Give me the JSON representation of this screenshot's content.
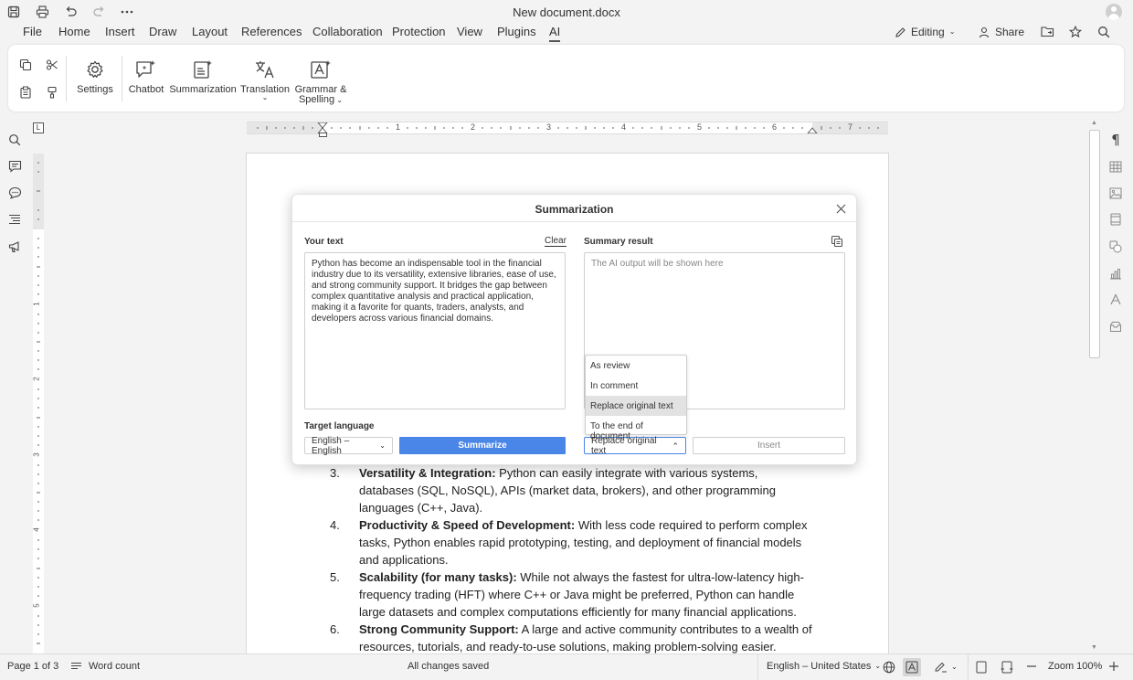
{
  "titlebar": {
    "document_title": "New document.docx"
  },
  "menu": {
    "tabs": [
      "File",
      "Home",
      "Insert",
      "Draw",
      "Layout",
      "References",
      "Collaboration",
      "Protection",
      "View",
      "Plugins",
      "AI"
    ],
    "active_tab": "AI",
    "editing_label": "Editing",
    "share_label": "Share"
  },
  "ribbon": {
    "settings": "Settings",
    "chatbot": "Chatbot",
    "summarization": "Summarization",
    "translation": "Translation",
    "grammar_line1": "Grammar &",
    "grammar_line2": "Spelling"
  },
  "ruler": {
    "h_numbers": [
      "1",
      "2",
      "3",
      "4",
      "5",
      "6",
      "7"
    ],
    "v_numbers": [
      "1",
      "2",
      "3",
      "4",
      "5"
    ]
  },
  "document": {
    "items": [
      {
        "num": "3.",
        "title": "Versatility & Integration:",
        "text": " Python can easily integrate with various systems, databases (SQL, NoSQL), APIs (market data, brokers), and other programming languages (C++, Java)."
      },
      {
        "num": "4.",
        "title": "Productivity & Speed of Development:",
        "text": " With less code required to perform complex tasks, Python enables rapid prototyping, testing, and deployment of financial models and applications."
      },
      {
        "num": "5.",
        "title": "Scalability (for many tasks):",
        "text": " While not always the fastest for ultra-low-latency high-frequency trading (HFT) where C++ or Java might be preferred, Python can handle large datasets and complex computations efficiently for many financial applications."
      },
      {
        "num": "6.",
        "title": "Strong Community Support:",
        "text": " A large and active community contributes to a wealth of resources, tutorials, and ready-to-use solutions, making problem-solving easier."
      }
    ]
  },
  "dialog": {
    "title": "Summarization",
    "your_text_label": "Your text",
    "clear_label": "Clear",
    "your_text_value": "Python has become an indispensable tool in the financial industry due to its versatility, extensive libraries, ease of use, and strong community support. It bridges the gap between complex quantitative analysis and practical application, making it a favorite for quants, traders, analysts, and developers across various financial domains.",
    "summary_label": "Summary result",
    "summary_placeholder": "The AI output will be shown here",
    "target_language_label": "Target language",
    "target_language_value": "English – English",
    "summarize_button": "Summarize",
    "insert_mode_value": "Replace original text",
    "insert_button": "Insert",
    "insert_options": [
      "As review",
      "In comment",
      "Replace original text",
      "To the end of document"
    ],
    "selected_option_index": 2
  },
  "statusbar": {
    "page_info": "Page 1 of 3",
    "word_count": "Word count",
    "save_status": "All changes saved",
    "language": "English – United States",
    "zoom": "Zoom 100%"
  },
  "colors": {
    "accent": "#4a86e8",
    "background": "#f3f3f3"
  }
}
